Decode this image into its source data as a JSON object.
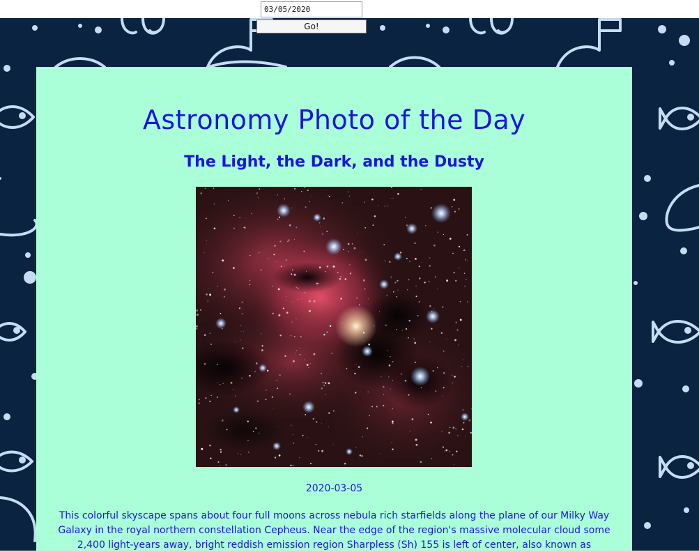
{
  "date_control": {
    "value": "03/05/2020",
    "go_label": "Go!"
  },
  "app": {
    "title": "Astronomy Photo of the Day"
  },
  "apod": {
    "title": "The Light, the Dark, and the Dusty",
    "date": "2020-03-05",
    "explanation": "This colorful skyscape spans about four full moons across nebula rich starfields along the plane of our Milky Way Galaxy in the royal northern constellation Cepheus. Near the edge of the region's massive molecular cloud some 2,400 light-years away, bright reddish emission region Sharpless (Sh) 155 is left of center, also known as"
  },
  "colors": {
    "page_background": "#0a2340",
    "card_background": "#aaffd8",
    "text_accent": "#1a16e0",
    "pattern_stroke": "#c6dcf2"
  },
  "icons": [
    "fish-icon",
    "planet-icon",
    "bubble-icon"
  ]
}
